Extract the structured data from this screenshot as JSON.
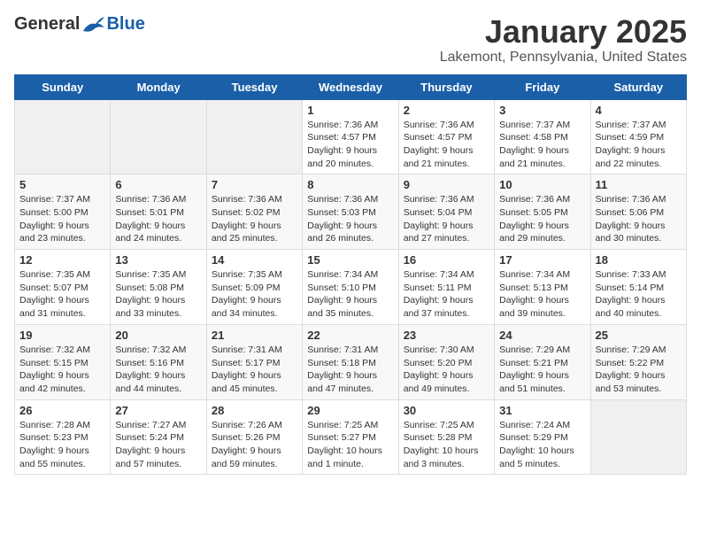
{
  "header": {
    "logo": {
      "general": "General",
      "blue": "Blue"
    },
    "title": "January 2025",
    "location": "Lakemont, Pennsylvania, United States"
  },
  "weekdays": [
    "Sunday",
    "Monday",
    "Tuesday",
    "Wednesday",
    "Thursday",
    "Friday",
    "Saturday"
  ],
  "weeks": [
    [
      {
        "day": "",
        "sunrise": "",
        "sunset": "",
        "daylight": ""
      },
      {
        "day": "",
        "sunrise": "",
        "sunset": "",
        "daylight": ""
      },
      {
        "day": "",
        "sunrise": "",
        "sunset": "",
        "daylight": ""
      },
      {
        "day": "1",
        "sunrise": "Sunrise: 7:36 AM",
        "sunset": "Sunset: 4:57 PM",
        "daylight": "Daylight: 9 hours and 20 minutes."
      },
      {
        "day": "2",
        "sunrise": "Sunrise: 7:36 AM",
        "sunset": "Sunset: 4:57 PM",
        "daylight": "Daylight: 9 hours and 21 minutes."
      },
      {
        "day": "3",
        "sunrise": "Sunrise: 7:37 AM",
        "sunset": "Sunset: 4:58 PM",
        "daylight": "Daylight: 9 hours and 21 minutes."
      },
      {
        "day": "4",
        "sunrise": "Sunrise: 7:37 AM",
        "sunset": "Sunset: 4:59 PM",
        "daylight": "Daylight: 9 hours and 22 minutes."
      }
    ],
    [
      {
        "day": "5",
        "sunrise": "Sunrise: 7:37 AM",
        "sunset": "Sunset: 5:00 PM",
        "daylight": "Daylight: 9 hours and 23 minutes."
      },
      {
        "day": "6",
        "sunrise": "Sunrise: 7:36 AM",
        "sunset": "Sunset: 5:01 PM",
        "daylight": "Daylight: 9 hours and 24 minutes."
      },
      {
        "day": "7",
        "sunrise": "Sunrise: 7:36 AM",
        "sunset": "Sunset: 5:02 PM",
        "daylight": "Daylight: 9 hours and 25 minutes."
      },
      {
        "day": "8",
        "sunrise": "Sunrise: 7:36 AM",
        "sunset": "Sunset: 5:03 PM",
        "daylight": "Daylight: 9 hours and 26 minutes."
      },
      {
        "day": "9",
        "sunrise": "Sunrise: 7:36 AM",
        "sunset": "Sunset: 5:04 PM",
        "daylight": "Daylight: 9 hours and 27 minutes."
      },
      {
        "day": "10",
        "sunrise": "Sunrise: 7:36 AM",
        "sunset": "Sunset: 5:05 PM",
        "daylight": "Daylight: 9 hours and 29 minutes."
      },
      {
        "day": "11",
        "sunrise": "Sunrise: 7:36 AM",
        "sunset": "Sunset: 5:06 PM",
        "daylight": "Daylight: 9 hours and 30 minutes."
      }
    ],
    [
      {
        "day": "12",
        "sunrise": "Sunrise: 7:35 AM",
        "sunset": "Sunset: 5:07 PM",
        "daylight": "Daylight: 9 hours and 31 minutes."
      },
      {
        "day": "13",
        "sunrise": "Sunrise: 7:35 AM",
        "sunset": "Sunset: 5:08 PM",
        "daylight": "Daylight: 9 hours and 33 minutes."
      },
      {
        "day": "14",
        "sunrise": "Sunrise: 7:35 AM",
        "sunset": "Sunset: 5:09 PM",
        "daylight": "Daylight: 9 hours and 34 minutes."
      },
      {
        "day": "15",
        "sunrise": "Sunrise: 7:34 AM",
        "sunset": "Sunset: 5:10 PM",
        "daylight": "Daylight: 9 hours and 35 minutes."
      },
      {
        "day": "16",
        "sunrise": "Sunrise: 7:34 AM",
        "sunset": "Sunset: 5:11 PM",
        "daylight": "Daylight: 9 hours and 37 minutes."
      },
      {
        "day": "17",
        "sunrise": "Sunrise: 7:34 AM",
        "sunset": "Sunset: 5:13 PM",
        "daylight": "Daylight: 9 hours and 39 minutes."
      },
      {
        "day": "18",
        "sunrise": "Sunrise: 7:33 AM",
        "sunset": "Sunset: 5:14 PM",
        "daylight": "Daylight: 9 hours and 40 minutes."
      }
    ],
    [
      {
        "day": "19",
        "sunrise": "Sunrise: 7:32 AM",
        "sunset": "Sunset: 5:15 PM",
        "daylight": "Daylight: 9 hours and 42 minutes."
      },
      {
        "day": "20",
        "sunrise": "Sunrise: 7:32 AM",
        "sunset": "Sunset: 5:16 PM",
        "daylight": "Daylight: 9 hours and 44 minutes."
      },
      {
        "day": "21",
        "sunrise": "Sunrise: 7:31 AM",
        "sunset": "Sunset: 5:17 PM",
        "daylight": "Daylight: 9 hours and 45 minutes."
      },
      {
        "day": "22",
        "sunrise": "Sunrise: 7:31 AM",
        "sunset": "Sunset: 5:18 PM",
        "daylight": "Daylight: 9 hours and 47 minutes."
      },
      {
        "day": "23",
        "sunrise": "Sunrise: 7:30 AM",
        "sunset": "Sunset: 5:20 PM",
        "daylight": "Daylight: 9 hours and 49 minutes."
      },
      {
        "day": "24",
        "sunrise": "Sunrise: 7:29 AM",
        "sunset": "Sunset: 5:21 PM",
        "daylight": "Daylight: 9 hours and 51 minutes."
      },
      {
        "day": "25",
        "sunrise": "Sunrise: 7:29 AM",
        "sunset": "Sunset: 5:22 PM",
        "daylight": "Daylight: 9 hours and 53 minutes."
      }
    ],
    [
      {
        "day": "26",
        "sunrise": "Sunrise: 7:28 AM",
        "sunset": "Sunset: 5:23 PM",
        "daylight": "Daylight: 9 hours and 55 minutes."
      },
      {
        "day": "27",
        "sunrise": "Sunrise: 7:27 AM",
        "sunset": "Sunset: 5:24 PM",
        "daylight": "Daylight: 9 hours and 57 minutes."
      },
      {
        "day": "28",
        "sunrise": "Sunrise: 7:26 AM",
        "sunset": "Sunset: 5:26 PM",
        "daylight": "Daylight: 9 hours and 59 minutes."
      },
      {
        "day": "29",
        "sunrise": "Sunrise: 7:25 AM",
        "sunset": "Sunset: 5:27 PM",
        "daylight": "Daylight: 10 hours and 1 minute."
      },
      {
        "day": "30",
        "sunrise": "Sunrise: 7:25 AM",
        "sunset": "Sunset: 5:28 PM",
        "daylight": "Daylight: 10 hours and 3 minutes."
      },
      {
        "day": "31",
        "sunrise": "Sunrise: 7:24 AM",
        "sunset": "Sunset: 5:29 PM",
        "daylight": "Daylight: 10 hours and 5 minutes."
      },
      {
        "day": "",
        "sunrise": "",
        "sunset": "",
        "daylight": ""
      }
    ]
  ]
}
